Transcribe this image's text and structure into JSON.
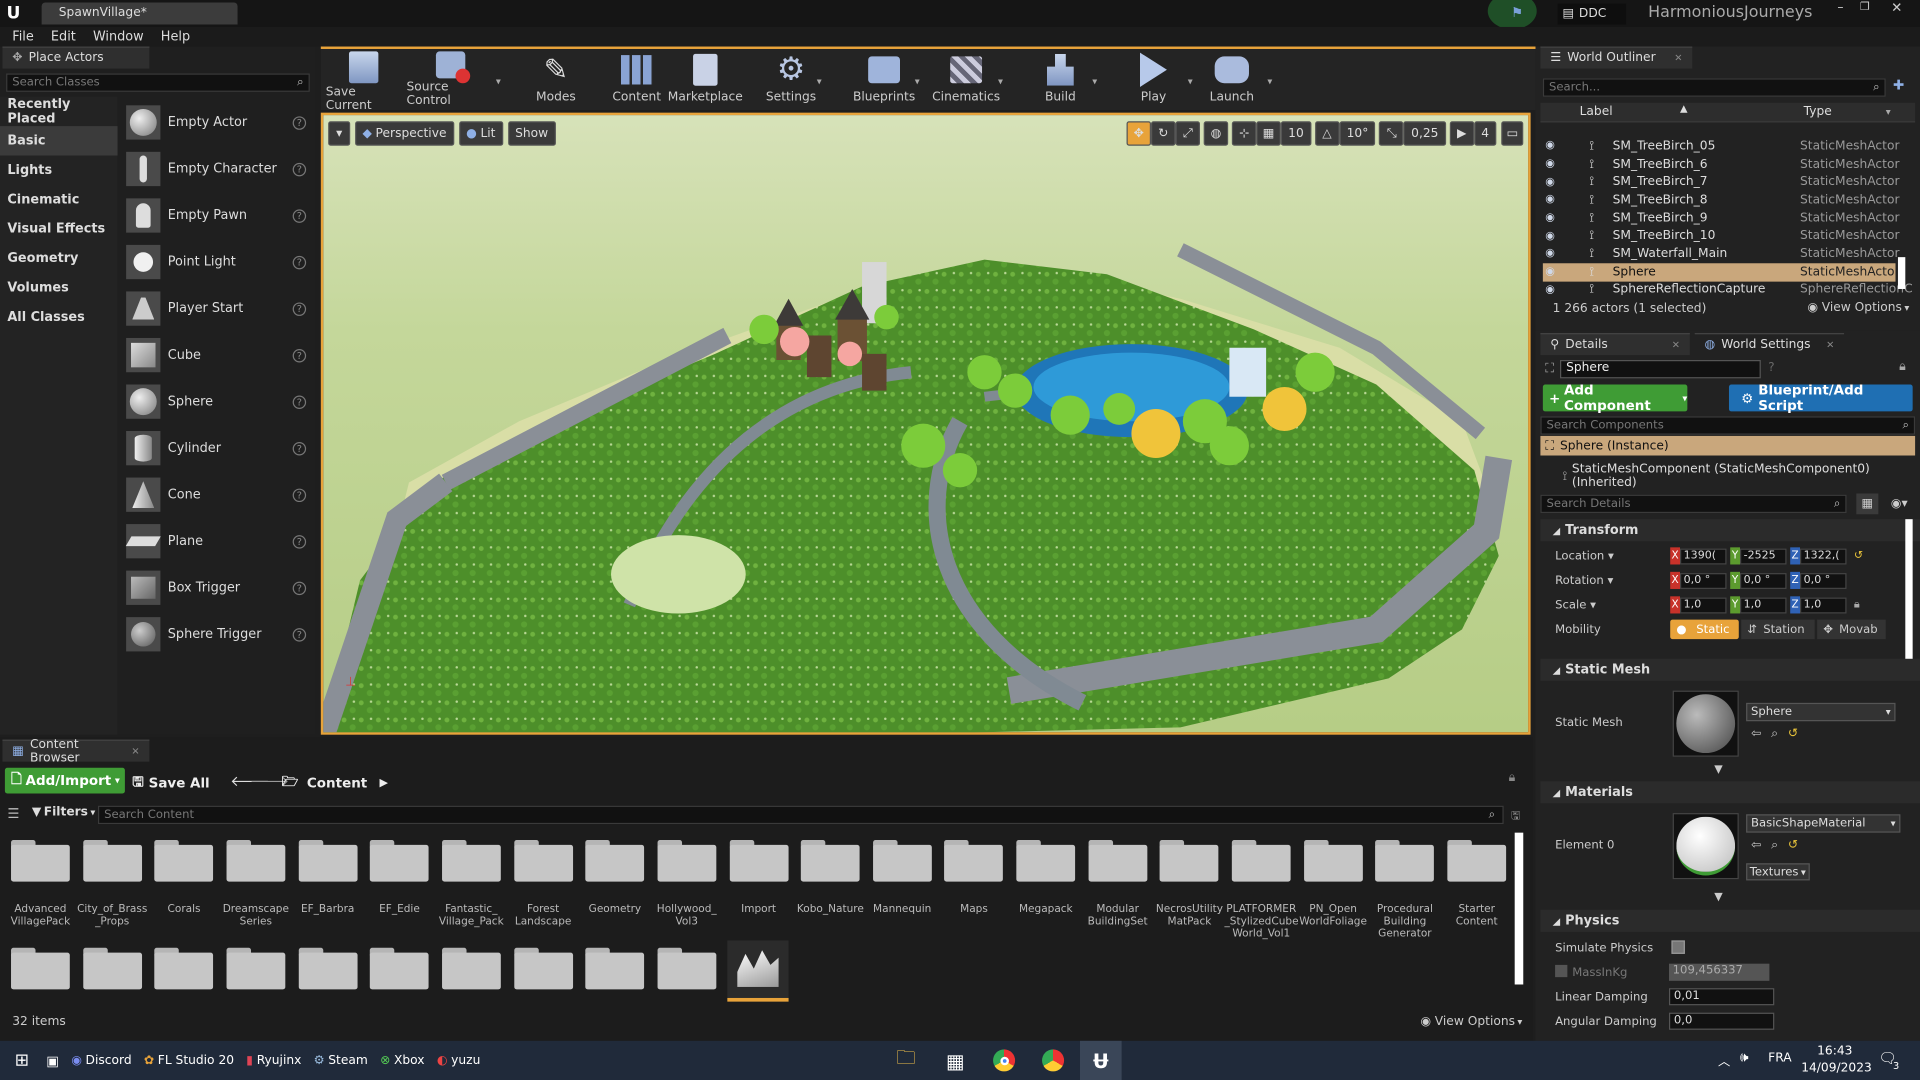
{
  "app": {
    "tab_title": "SpawnVillage*",
    "ddc_label": "DDC",
    "project_name": "HarmoniousJourneys"
  },
  "menu": [
    "File",
    "Edit",
    "Window",
    "Help"
  ],
  "place_actors": {
    "tab_label": "Place Actors",
    "search_placeholder": "Search Classes",
    "categories": [
      "Recently Placed",
      "Basic",
      "Lights",
      "Cinematic",
      "Visual Effects",
      "Geometry",
      "Volumes",
      "All Classes"
    ],
    "selected_category": "Basic",
    "actors": [
      "Empty Actor",
      "Empty Character",
      "Empty Pawn",
      "Point Light",
      "Player Start",
      "Cube",
      "Sphere",
      "Cylinder",
      "Cone",
      "Plane",
      "Box Trigger",
      "Sphere Trigger"
    ]
  },
  "toolbar": {
    "save_current": "Save Current",
    "source_control": "Source Control",
    "modes": "Modes",
    "content": "Content",
    "marketplace": "Marketplace",
    "settings": "Settings",
    "blueprints": "Blueprints",
    "cinematics": "Cinematics",
    "build": "Build",
    "play": "Play",
    "launch": "Launch"
  },
  "viewport": {
    "perspective": "Perspective",
    "lit": "Lit",
    "show": "Show",
    "grid_snap": "10",
    "rotation_snap": "10°",
    "scale_snap": "0,25",
    "camera_speed": "4"
  },
  "outliner": {
    "tab_label": "World Outliner",
    "search_placeholder": "Search...",
    "col_label": "Label",
    "col_type": "Type",
    "rows": [
      {
        "label": "SM_TreeBirch_05",
        "type": "StaticMeshActor"
      },
      {
        "label": "SM_TreeBirch_6",
        "type": "StaticMeshActor"
      },
      {
        "label": "SM_TreeBirch_7",
        "type": "StaticMeshActor"
      },
      {
        "label": "SM_TreeBirch_8",
        "type": "StaticMeshActor"
      },
      {
        "label": "SM_TreeBirch_9",
        "type": "StaticMeshActor"
      },
      {
        "label": "SM_TreeBirch_10",
        "type": "StaticMeshActor"
      },
      {
        "label": "SM_Waterfall_Main",
        "type": "StaticMeshActor"
      },
      {
        "label": "Sphere",
        "type": "StaticMeshActor"
      },
      {
        "label": "SphereReflectionCapture",
        "type": "SphereReflectionC"
      }
    ],
    "selected_row": "Sphere",
    "actor_count": "1 266 actors (1 selected)",
    "view_options": "View Options"
  },
  "details": {
    "tab_label": "Details",
    "world_settings_tab": "World Settings",
    "name": "Sphere",
    "add_component": "Add Component",
    "blueprint_script": "Blueprint/Add Script",
    "search_components": "Search Components",
    "instance": "Sphere (Instance)",
    "component": "StaticMeshComponent (StaticMeshComponent0) (Inherited)",
    "search_details": "Search Details",
    "transform": {
      "section": "Transform",
      "location_label": "Location",
      "rotation_label": "Rotation",
      "scale_label": "Scale",
      "mobility_label": "Mobility",
      "location": [
        "1390(",
        "-2525",
        "1322,("
      ],
      "rotation": [
        "0,0 °",
        "0,0 °",
        "0,0 °"
      ],
      "scale": [
        "1,0",
        "1,0",
        "1,0"
      ],
      "mobility": [
        "Static",
        "Station",
        "Movab"
      ]
    },
    "static_mesh": {
      "section": "Static Mesh",
      "label": "Static Mesh",
      "value": "Sphere"
    },
    "materials": {
      "section": "Materials",
      "label": "Element 0",
      "value": "BasicShapeMaterial",
      "textures": "Textures"
    },
    "physics": {
      "section": "Physics",
      "simulate_label": "Simulate Physics",
      "mass_label": "MassInKg",
      "mass_value": "109,456337",
      "linear_label": "Linear Damping",
      "linear_value": "0,01",
      "angular_label": "Angular Damping",
      "angular_value": "0,0"
    }
  },
  "content_browser": {
    "tab_label": "Content Browser",
    "add_import": "Add/Import",
    "save_all": "Save All",
    "path": "Content",
    "filters": "Filters",
    "search_placeholder": "Search Content",
    "folders": [
      "Advanced VillagePack",
      "City_of_Brass _Props",
      "Corals",
      "Dreamscape Series",
      "EF_Barbra",
      "EF_Edie",
      "Fantastic_ Village_Pack",
      "Forest Landscape",
      "Geometry",
      "Hollywood_ Vol3",
      "Import",
      "Kobo_Nature",
      "Mannequin",
      "Maps",
      "Megapack",
      "Modular BuildingSet",
      "NecrosUtility MatPack",
      "PLATFORMER _StylizedCube World_Vol1",
      "PN_Open WorldFoliage",
      "Procedural Building Generator",
      "Starter Content"
    ],
    "item_count": "32 items",
    "view_options": "View Options"
  },
  "taskbar": {
    "apps": [
      "Discord",
      "FL Studio 20",
      "Ryujinx",
      "Steam",
      "Xbox",
      "yuzu"
    ],
    "language": "FRA",
    "time": "16:43",
    "date": "14/09/2023",
    "notification_count": "3"
  },
  "colors": {
    "accent_orange": "#e8a33a",
    "add_green": "#3f9c35",
    "blueprint_blue": "#1f6fb3",
    "selection": "#c9a77c"
  }
}
